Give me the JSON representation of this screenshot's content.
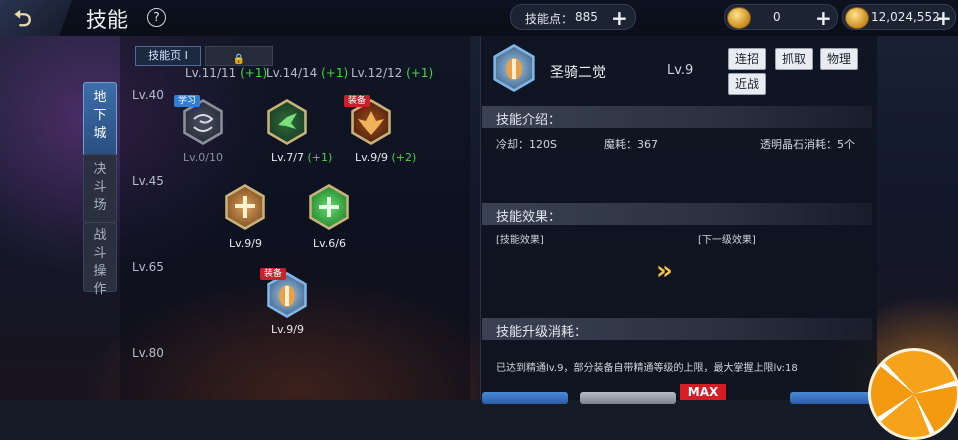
{
  "header": {
    "back_icon_glyph": "⮌",
    "title": "技能",
    "help_glyph": "?",
    "skill_points_label": "技能点：",
    "skill_points_value": "885",
    "currency1_value": "0",
    "currency2_value": "12,024,552",
    "plus_glyph": "+"
  },
  "side_tabs": [
    {
      "label": "地下城",
      "active": true
    },
    {
      "label": "决斗场",
      "active": false
    },
    {
      "label": "战斗操作",
      "active": false
    }
  ],
  "tree": {
    "page_tab": "技能页 I",
    "lock_glyph": "🔒",
    "levels": [
      "Lv.40",
      "Lv.45",
      "Lv.65",
      "Lv.80"
    ],
    "top_levels": [
      {
        "text": "Lv.11/11",
        "bonus": "(+1)"
      },
      {
        "text": "Lv.14/14",
        "bonus": "(+1)"
      },
      {
        "text": "Lv.12/12",
        "bonus": "(+1)"
      }
    ],
    "skills": [
      {
        "id": "wind",
        "level": "Lv.0/10",
        "bonus": "",
        "badge": "学习",
        "badge_type": "learn"
      },
      {
        "id": "bird",
        "level": "Lv.7/7",
        "bonus": "(+1)",
        "badge": "",
        "badge_type": ""
      },
      {
        "id": "phoenix",
        "level": "Lv.9/9",
        "bonus": "(+2)",
        "badge": "装备",
        "badge_type": "equip"
      },
      {
        "id": "cross-light",
        "level": "Lv.9/9",
        "bonus": "",
        "badge": "",
        "badge_type": ""
      },
      {
        "id": "green-cross",
        "level": "Lv.6/6",
        "bonus": "",
        "badge": "",
        "badge_type": ""
      },
      {
        "id": "paladin",
        "level": "Lv.9/9",
        "bonus": "",
        "badge": "装备",
        "badge_type": "equip"
      }
    ]
  },
  "detail": {
    "skill_name": "圣骑二觉",
    "skill_level": "Lv.9",
    "tags": [
      "连招",
      "抓取",
      "物理",
      "近战"
    ],
    "section_intro": "技能介绍：",
    "cooldown": "冷却：120S",
    "mana": "魔耗：367",
    "crystal_cost": "透明晶石消耗：5个",
    "section_effect": "技能效果：",
    "effect_current": "[技能效果]",
    "effect_next": "[下一级效果]",
    "next_arrow_glyph": "»",
    "section_upgrade": "技能升级消耗：",
    "upgrade_note": "已达到精通lv.9，部分装备自带精通等级的上限，最大掌握上限lv:18",
    "max_label": "MAX"
  },
  "colors": {
    "accent_blue": "#3c6ea8",
    "bonus_green": "#4ad24a",
    "equip_red": "#c9202a",
    "gold": "#c7b27a"
  }
}
